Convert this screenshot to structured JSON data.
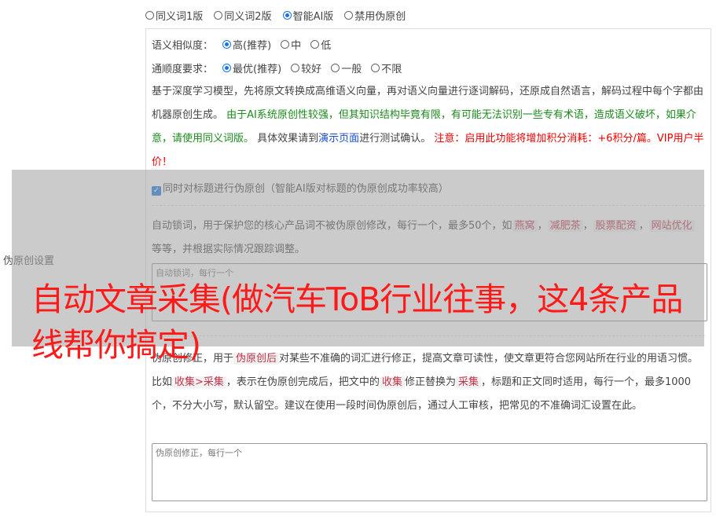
{
  "top_options": [
    {
      "label": "同义词1版",
      "checked": false
    },
    {
      "label": "同义词2版",
      "checked": false
    },
    {
      "label": "智能AI版",
      "checked": true
    },
    {
      "label": "禁用伪原创",
      "checked": false
    }
  ],
  "side_label": "伪原创设置",
  "similarity": {
    "label": "语义相似度：",
    "options": [
      {
        "label": "高(推荐)",
        "checked": true
      },
      {
        "label": "中",
        "checked": false
      },
      {
        "label": "低",
        "checked": false
      }
    ]
  },
  "fluency": {
    "label": "通顺度要求：",
    "options": [
      {
        "label": "最优(推荐)",
        "checked": true
      },
      {
        "label": "较好",
        "checked": false
      },
      {
        "label": "一般",
        "checked": false
      },
      {
        "label": "不限",
        "checked": false
      }
    ]
  },
  "description": {
    "part1": "基于深度学习模型，先将原文转换成高维语义向量，再对语义向量进行逐词解码，还原成自然语言，解码过程中每个字都由机器原创生成。",
    "green": "由于AI系统原创性较强，但其知识结构毕竟有限，有可能无法识别一些专有术语，造成语义破坏，如果介意，请使用同义词版。",
    "part2": "具体效果请到",
    "link": "演示页面",
    "part3": "进行测试确认。",
    "red": "注意：启用此功能将增加积分消耗：+6积分/篇。VIP用户半价！"
  },
  "title_checkbox": {
    "label": "同时对标题进行伪原创（智能AI版对标题的伪原创成功率较高）",
    "checked": true
  },
  "lock_words": {
    "text_before": "自动锁词，用于保护您的核心产品词不被伪原创修改，每行一个，最多50个，如",
    "tags": [
      "燕窝",
      "减肥茶",
      "股票配资",
      "网站优化"
    ],
    "sep": "，",
    "text_after": "等等，并根据实际情况跟踪调整。",
    "placeholder": "自动锁词，每行一个"
  },
  "correction": {
    "text1": "伪原创修正，用于",
    "tag1": "伪原创后",
    "text2": "对某些不准确的词汇进行修正，提高文章可读性，使文章更符合您网站所在行业的用语习惯。比如",
    "tag2": "收集>采集",
    "text3": "，表示在伪原创完成后，把文中的",
    "tag3": "收集",
    "text4": "修正替换为",
    "tag4": "采集",
    "text5": "，标题和正文同时适用，每行一个，最多1000个，不分大小写，默认留空。建议在使用一段时间伪原创后，通过人工审核，把常见的不准确词汇设置在此。",
    "placeholder": "伪原创修正，每行一个"
  },
  "headline": "自动文章采集(做汽车ToB行业往事，这4条产品线帮你搞定)"
}
